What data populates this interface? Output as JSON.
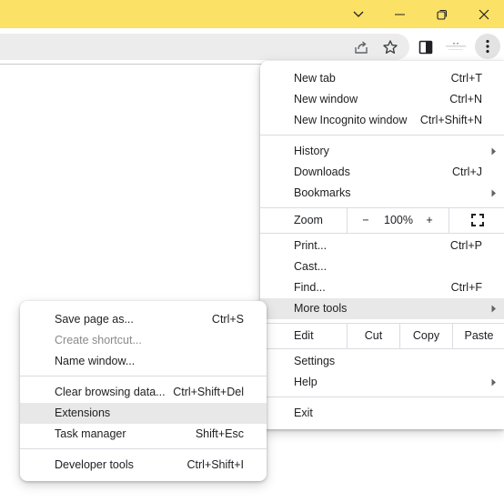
{
  "window_controls": {
    "tab_search": "chevron-down-icon",
    "minimize": "minimize-icon",
    "restore": "restore-icon",
    "close": "close-icon",
    "titlebar_color": "#fbe165"
  },
  "toolbar": {
    "share": "share-icon",
    "bookmark": "star-icon",
    "side_panel": "side-panel-icon",
    "menu": "kebab-icon"
  },
  "main_menu": {
    "new_tab": {
      "label": "New tab",
      "shortcut": "Ctrl+T"
    },
    "new_window": {
      "label": "New window",
      "shortcut": "Ctrl+N"
    },
    "new_incognito": {
      "label": "New Incognito window",
      "shortcut": "Ctrl+Shift+N"
    },
    "history": {
      "label": "History"
    },
    "downloads": {
      "label": "Downloads",
      "shortcut": "Ctrl+J"
    },
    "bookmarks": {
      "label": "Bookmarks"
    },
    "zoom": {
      "label": "Zoom",
      "minus": "−",
      "value": "100%",
      "plus": "+"
    },
    "print": {
      "label": "Print...",
      "shortcut": "Ctrl+P"
    },
    "cast": {
      "label": "Cast..."
    },
    "find": {
      "label": "Find...",
      "shortcut": "Ctrl+F"
    },
    "more_tools": {
      "label": "More tools"
    },
    "edit": {
      "label": "Edit",
      "cut": "Cut",
      "copy": "Copy",
      "paste": "Paste"
    },
    "settings": {
      "label": "Settings"
    },
    "help": {
      "label": "Help"
    },
    "exit": {
      "label": "Exit"
    }
  },
  "more_tools_menu": {
    "save_page": {
      "label": "Save page as...",
      "shortcut": "Ctrl+S"
    },
    "create_shortcut": {
      "label": "Create shortcut..."
    },
    "name_window": {
      "label": "Name window..."
    },
    "clear_data": {
      "label": "Clear browsing data...",
      "shortcut": "Ctrl+Shift+Del"
    },
    "extensions": {
      "label": "Extensions"
    },
    "task_manager": {
      "label": "Task manager",
      "shortcut": "Shift+Esc"
    },
    "dev_tools": {
      "label": "Developer tools",
      "shortcut": "Ctrl+Shift+I"
    }
  }
}
